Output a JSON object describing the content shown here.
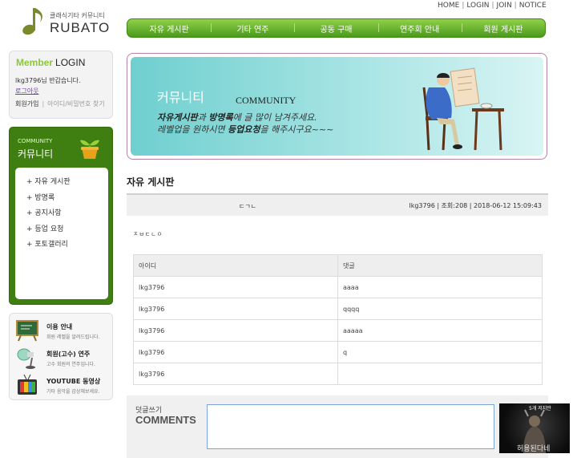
{
  "toplinks": [
    "HOME",
    "LOGIN",
    "JOIN",
    "NOTICE"
  ],
  "logo": {
    "small": "클래식기타 커뮤니티",
    "big": "RUBATO"
  },
  "mainnav": [
    "자유 게시판",
    "기타 연주",
    "공동 구매",
    "연주회 안내",
    "회원 게시판"
  ],
  "login": {
    "member": "Member",
    "login": "LOGIN",
    "greeting": "lkg3796님 반갑습니다.",
    "logout": "로그아웃",
    "join": "회원가입",
    "find": "아이디/비밀번호 찾기"
  },
  "community": {
    "caption": "COMMUNITY",
    "title": "커뮤니티",
    "items": [
      "+ 자유 게시판",
      "+ 방명록",
      "+ 공지사항",
      "+ 등업 요청",
      "+ 포토갤러리"
    ]
  },
  "sideinfo": [
    {
      "title": "이용 안내",
      "sub": "회원 레벨을 알려드립니다.",
      "icon": "board-icon"
    },
    {
      "title": "회원(고수) 연주",
      "sub": "고수 회원의 연주입니다.",
      "icon": "lamp-icon"
    },
    {
      "title": "YOUTUBE 동영상",
      "sub": "기타 음악을 감상해보세요.",
      "icon": "tv-icon"
    }
  ],
  "banner": {
    "ko": "커뮤니티",
    "en": "COMMUNITY",
    "line1_a": "자유게시판",
    "line1_b": "과 ",
    "line1_c": "방명록",
    "line1_d": "에 글 많이 남겨주세요.",
    "line2_a": "레벨업을 원하시면 ",
    "line2_b": "등업요청",
    "line2_c": "을 해주시구요~~~"
  },
  "board": {
    "title": "자유 게시판",
    "post_title": "ㄷㄱㄴ",
    "post_meta": "lkg3796 | 조회:208 | 2018-06-12 15:09:43",
    "post_body": "ㅈㅂㄷㄴㅇ",
    "headers": [
      "아이디",
      "댓글"
    ],
    "comments": [
      {
        "id": "lkg3796",
        "text": "aaaa"
      },
      {
        "id": "lkg3796",
        "text": "qqqq"
      },
      {
        "id": "lkg3796",
        "text": "aaaaa"
      },
      {
        "id": "lkg3796",
        "text": "q"
      },
      {
        "id": "lkg3796",
        "text": ""
      }
    ]
  },
  "comment_form": {
    "label": "덧글쓰기",
    "big": "COMMENTS",
    "value": ""
  },
  "poster": {
    "top": "5개 저지만",
    "bottom": "허용된다네"
  },
  "colors": {
    "nav_green": "#4b9a1c",
    "side_green": "#3f7f12",
    "member_green": "#8cc63f",
    "banner_teal": "#6fcfcf"
  }
}
